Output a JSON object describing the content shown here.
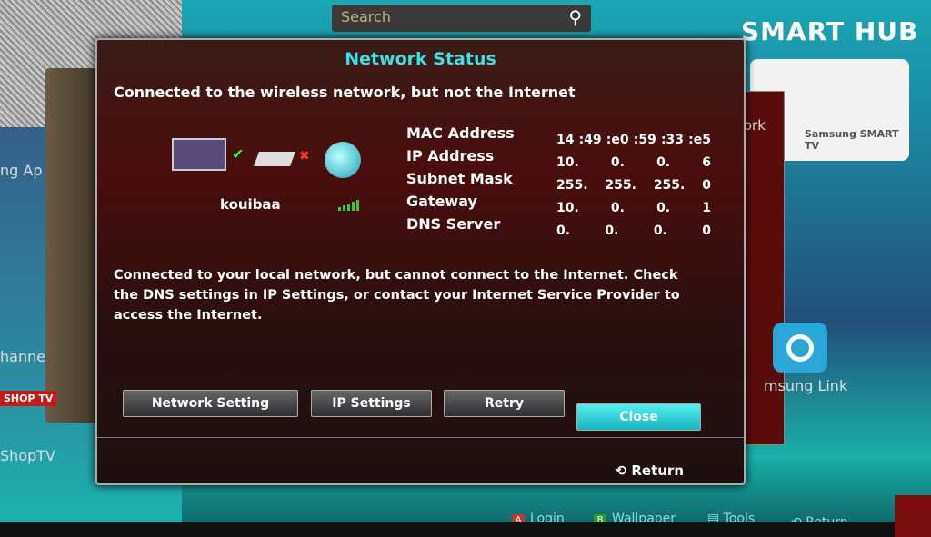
{
  "search": {
    "placeholder": "Search",
    "icon": "search-icon"
  },
  "brand": {
    "logo": "SMART HUB",
    "promo": "Samsung SMART TV"
  },
  "background_apps": {
    "left_partial_1": "ng Ap",
    "left_partial_2": "hanne",
    "shop_badge": "SHOP TV",
    "shop_label": "ShopTV",
    "right_partial": "vork",
    "samsung_link": "msung Link"
  },
  "dialog": {
    "title": "Network Status",
    "headline": "Connected to the wireless network, but not the Internet",
    "ssid": "kouibaa",
    "signal_level": 5,
    "router_status": "connected",
    "internet_status": "disconnected",
    "fields": [
      {
        "label": "MAC Address",
        "value": [
          "14",
          ":49",
          ":e0",
          ":59",
          ":33",
          ":e5"
        ]
      },
      {
        "label": "IP Address",
        "value": [
          "10.",
          "0.",
          "0.",
          "6"
        ]
      },
      {
        "label": "Subnet Mask",
        "value": [
          "255.",
          "255.",
          "255.",
          "0"
        ]
      },
      {
        "label": "Gateway",
        "value": [
          "10.",
          "0.",
          "0.",
          "1"
        ]
      },
      {
        "label": "DNS Server",
        "value": [
          "0.",
          "0.",
          "0.",
          "0"
        ]
      }
    ],
    "message": "Connected to your local network, but cannot connect to the Internet.  Check the DNS settings in IP Settings, or contact your Internet Service Provider to access the Internet.",
    "buttons": {
      "network_setting": "Network Setting",
      "ip_settings": "IP Settings",
      "retry": "Retry",
      "close": "Close"
    },
    "return": "Return"
  },
  "footer": {
    "login": "Login",
    "login_key": "A",
    "wallpaper": "Wallpaper",
    "wallpaper_key": "B",
    "tools": "Tools",
    "return": "Return"
  },
  "colors": {
    "accent": "#3ee0e6",
    "key_a": "#c0392b",
    "key_b": "#2e9a2e"
  }
}
